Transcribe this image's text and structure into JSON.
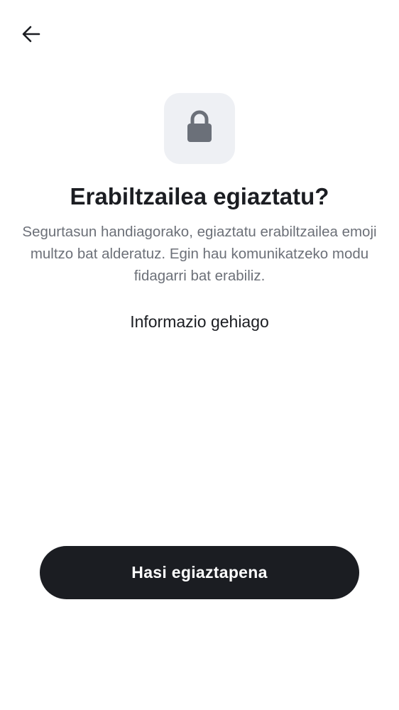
{
  "header": {
    "back_icon": "arrow-left-icon"
  },
  "hero": {
    "icon": "lock-icon",
    "icon_color": "#6b7079",
    "tile_color": "#eef0f4"
  },
  "content": {
    "title": "Erabiltzailea egiaztatu?",
    "description": "Segurtasun handiagorako, egiaztatu erabiltzailea emoji multzo bat alderatuz. Egin hau komunikatzeko modu fidagarri bat erabiliz.",
    "more_info_link": "Informazio gehiago"
  },
  "actions": {
    "start_button_label": "Hasi egiaztapena",
    "button_color": "#1b1d22"
  }
}
